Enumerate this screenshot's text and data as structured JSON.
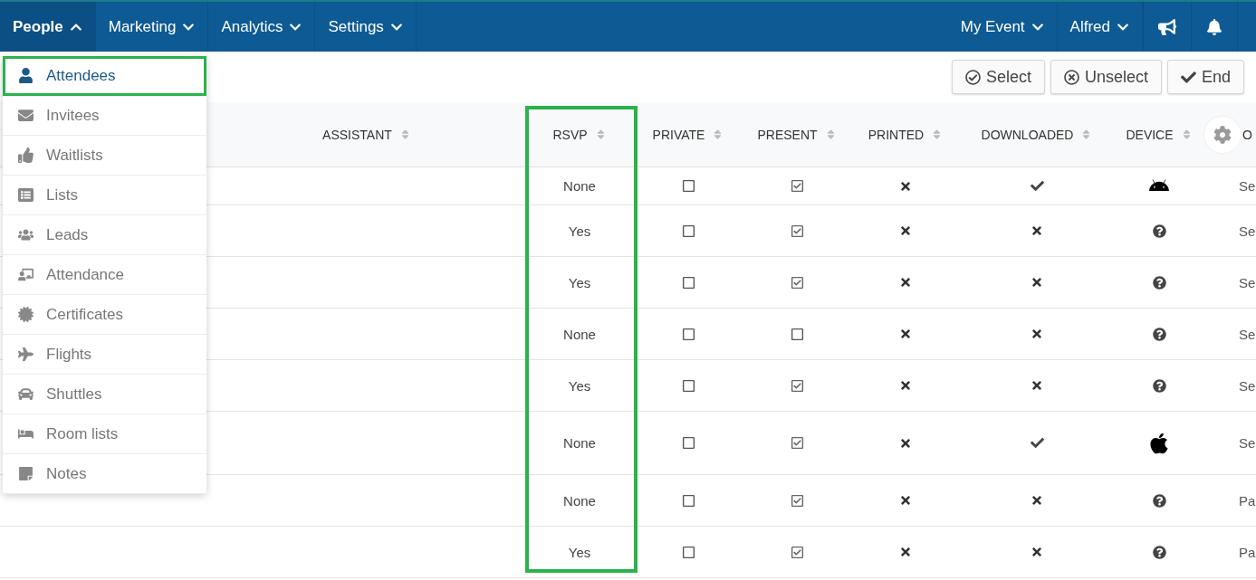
{
  "nav": {
    "left": [
      {
        "label": "People",
        "expanded": true
      },
      {
        "label": "Marketing",
        "expanded": false
      },
      {
        "label": "Analytics",
        "expanded": false
      },
      {
        "label": "Settings",
        "expanded": false
      }
    ],
    "right": [
      {
        "label": "My Event",
        "expanded": false
      },
      {
        "label": "Alfred",
        "expanded": false
      }
    ]
  },
  "toolbar": {
    "buttons": [
      {
        "label": "Select"
      },
      {
        "label": "Unselect"
      },
      {
        "label": "End"
      }
    ]
  },
  "menu": {
    "items": [
      {
        "label": "Attendees",
        "selected": true
      },
      {
        "label": "Invitees",
        "selected": false
      },
      {
        "label": "Waitlists",
        "selected": false
      },
      {
        "label": "Lists",
        "selected": false
      },
      {
        "label": "Leads",
        "selected": false
      },
      {
        "label": "Attendance",
        "selected": false
      },
      {
        "label": "Certificates",
        "selected": false
      },
      {
        "label": "Flights",
        "selected": false
      },
      {
        "label": "Shuttles",
        "selected": false
      },
      {
        "label": "Room lists",
        "selected": false
      },
      {
        "label": "Notes",
        "selected": false
      }
    ]
  },
  "table": {
    "columns": [
      "ASSISTANT",
      "RSVP",
      "PRIVATE",
      "PRESENT",
      "PRINTED",
      "DOWNLOADED",
      "DEVICE",
      "O"
    ],
    "rows": [
      {
        "rsvp": "None",
        "private": false,
        "present": true,
        "printed": false,
        "downloaded": true,
        "device": {
          "kind": "android"
        },
        "column_8": "Se"
      },
      {
        "rsvp": "Yes",
        "private": false,
        "present": true,
        "printed": false,
        "downloaded": false,
        "device": {
          "kind": "unknown"
        },
        "column_8": "Se"
      },
      {
        "rsvp": "Yes",
        "private": false,
        "present": true,
        "printed": false,
        "downloaded": false,
        "device": {
          "kind": "unknown"
        },
        "column_8": "Se"
      },
      {
        "rsvp": "None",
        "private": false,
        "present": false,
        "printed": false,
        "downloaded": false,
        "device": {
          "kind": "unknown"
        },
        "column_8": "Se"
      },
      {
        "rsvp": "Yes",
        "private": false,
        "present": true,
        "printed": false,
        "downloaded": false,
        "device": {
          "kind": "unknown"
        },
        "column_8": "Se"
      },
      {
        "rsvp": "None",
        "private": false,
        "present": true,
        "printed": false,
        "downloaded": true,
        "device": {
          "kind": "apple"
        },
        "column_8": "Se"
      },
      {
        "rsvp": "None",
        "private": false,
        "present": true,
        "printed": false,
        "downloaded": false,
        "device": {
          "kind": "unknown"
        },
        "column_8": "Pa"
      },
      {
        "rsvp": "Yes",
        "private": false,
        "present": true,
        "printed": false,
        "downloaded": false,
        "device": {
          "kind": "unknown"
        },
        "column_8": "Pa"
      }
    ]
  }
}
